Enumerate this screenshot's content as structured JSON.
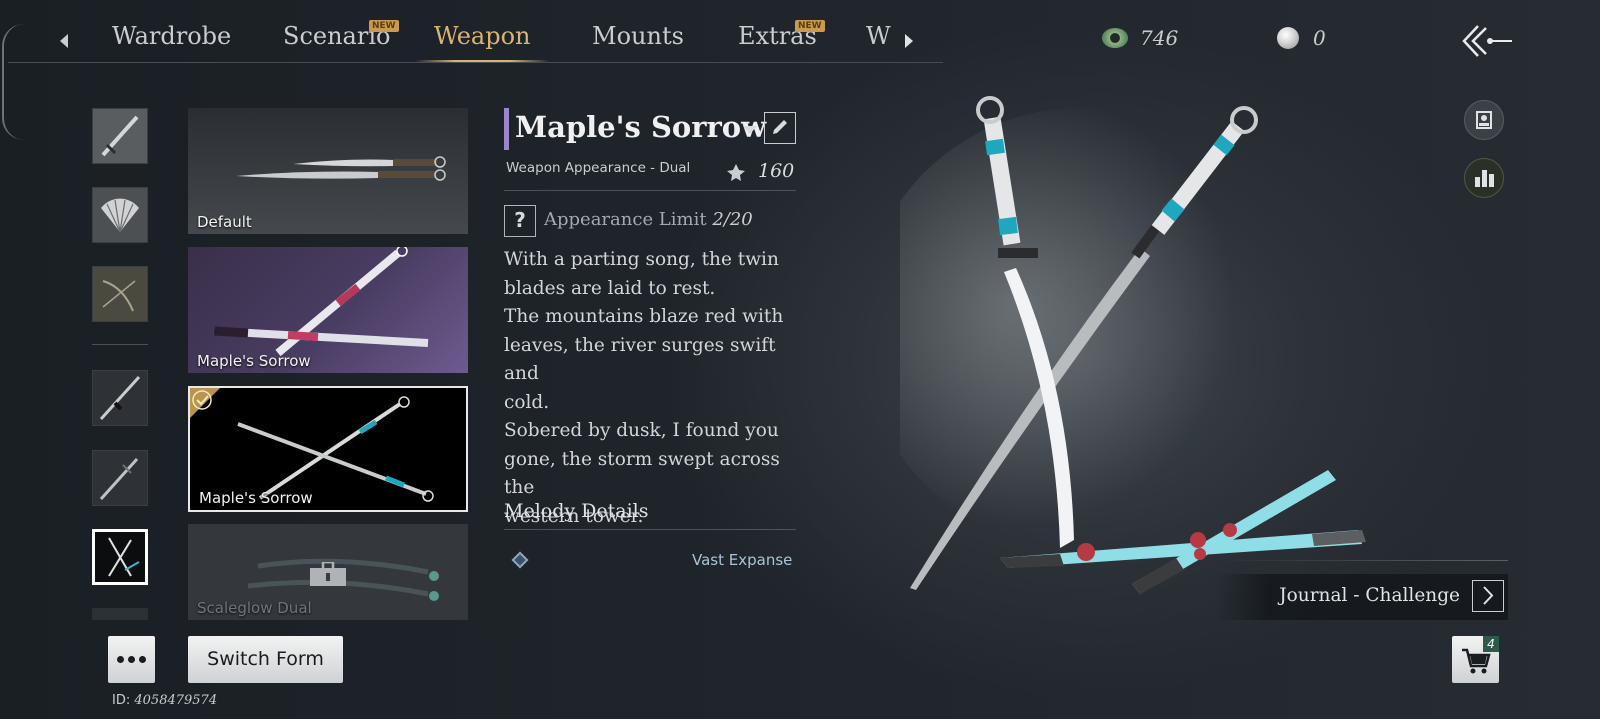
{
  "tabs": [
    {
      "label": "Wardrobe",
      "badge": ""
    },
    {
      "label": "Scenario",
      "badge": "NEW"
    },
    {
      "label": "Weapon",
      "badge": ""
    },
    {
      "label": "Mounts",
      "badge": ""
    },
    {
      "label": "Extras",
      "badge": "NEW"
    },
    {
      "label": "W",
      "badge": ""
    }
  ],
  "active_tab": "Weapon",
  "currency": {
    "jade": "746",
    "pearl": "0"
  },
  "skins": [
    {
      "name": "Default",
      "selected": false,
      "locked": false
    },
    {
      "name": "Maple's Sorrow",
      "selected": false,
      "locked": false
    },
    {
      "name": "Maple's Sorrow",
      "selected": true,
      "locked": false
    },
    {
      "name": "Scaleglow Dual",
      "selected": false,
      "locked": true
    }
  ],
  "detail": {
    "title": "Maple's Sorrow",
    "subtitle": "Weapon Appearance - Dual",
    "score": "160",
    "limit_label": "Appearance Limit",
    "limit_value": "2/20",
    "question_mark": "?",
    "description": [
      "With a parting song, the twin",
      "blades are laid to rest.",
      "The mountains blaze red with",
      "leaves, the river surges swift and",
      "cold.",
      "Sobered by dusk, I found you",
      "gone, the storm swept across the",
      "western tower."
    ],
    "melody_heading": "Melody Details",
    "melody_item": "Vast Expanse"
  },
  "buttons": {
    "more": "•••",
    "switch_form": "Switch Form"
  },
  "id_label": "ID:",
  "id_value": "4058479574",
  "journal": {
    "label": "Journal - Challenge"
  },
  "cart_count": "4",
  "colors": {
    "accent_gold": "#d8b477",
    "title_bar": "#9a87c7",
    "melody_text": "#a8c4d6"
  }
}
